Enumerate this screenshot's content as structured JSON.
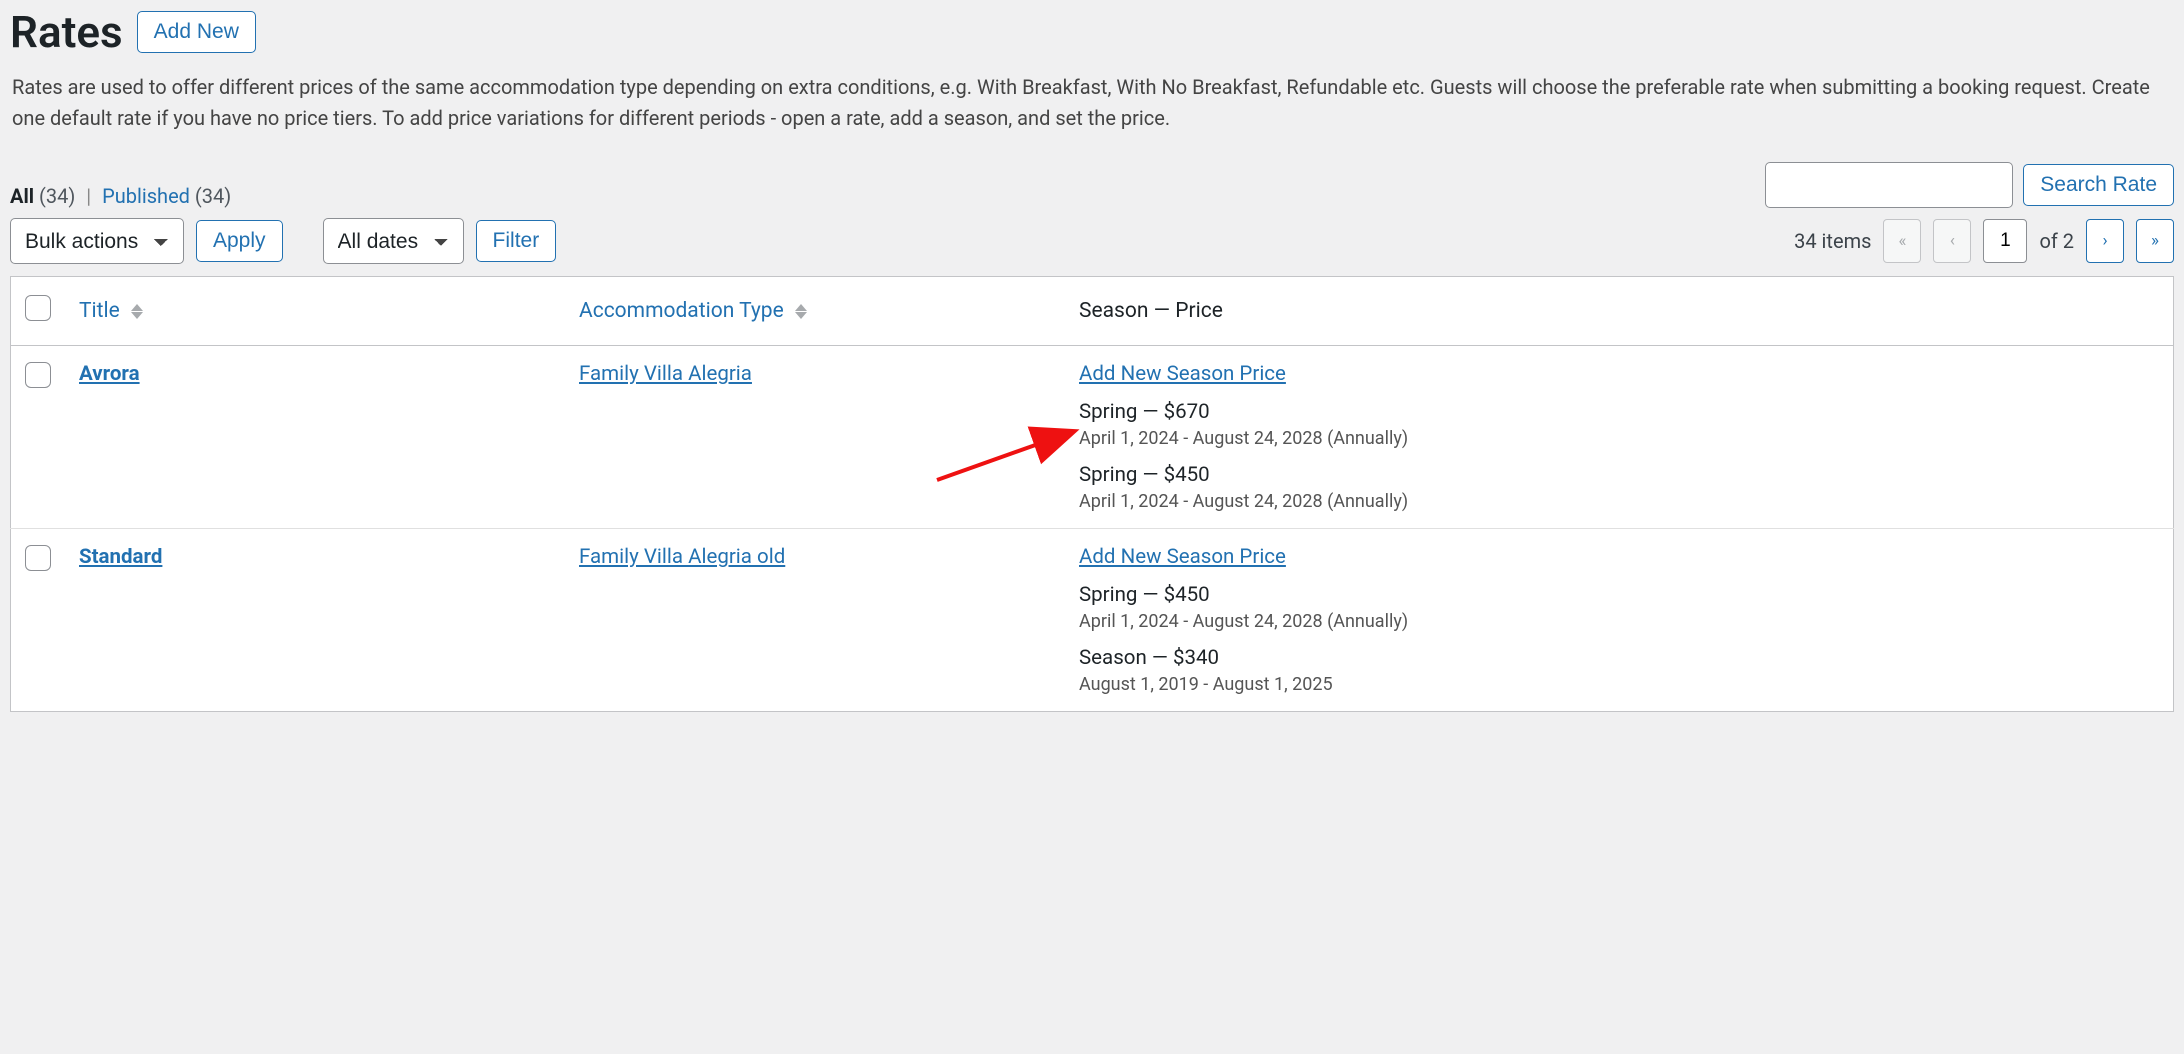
{
  "header": {
    "title": "Rates",
    "add_new": "Add New"
  },
  "description": "Rates are used to offer different prices of the same accommodation type depending on extra conditions, e.g. With Breakfast, With No Breakfast, Refundable etc. Guests will choose the preferable rate when submitting a booking request. Create one default rate if you have no price tiers. To add price variations for different periods - open a rate, add a season, and set the price.",
  "filters": {
    "all_label": "All",
    "all_count": "(34)",
    "published_label": "Published",
    "published_count": "(34)",
    "separator": "|"
  },
  "search": {
    "button": "Search Rate",
    "value": ""
  },
  "tablenav": {
    "bulk_actions": "Bulk actions",
    "apply": "Apply",
    "all_dates": "All dates",
    "filter": "Filter",
    "items_label": "34 items",
    "current_page": "1",
    "of_label": "of 2"
  },
  "columns": {
    "title": "Title",
    "accommodation": "Accommodation Type",
    "season_price": "Season — Price"
  },
  "add_new_season_price": "Add New Season Price",
  "rows": [
    {
      "title": "Avrora",
      "accommodation": "Family Villa Alegria",
      "seasons": [
        {
          "line": "Spring — $670",
          "detail": "April 1, 2024 - August 24, 2028 (Annually)"
        },
        {
          "line": "Spring — $450",
          "detail": "April 1, 2024 - August 24, 2028 (Annually)"
        }
      ]
    },
    {
      "title": "Standard",
      "accommodation": "Family Villa Alegria old",
      "seasons": [
        {
          "line": "Spring — $450",
          "detail": "April 1, 2024 - August 24, 2028 (Annually)"
        },
        {
          "line": "Season — $340",
          "detail": "August 1, 2019 - August 1, 2025"
        }
      ]
    }
  ]
}
